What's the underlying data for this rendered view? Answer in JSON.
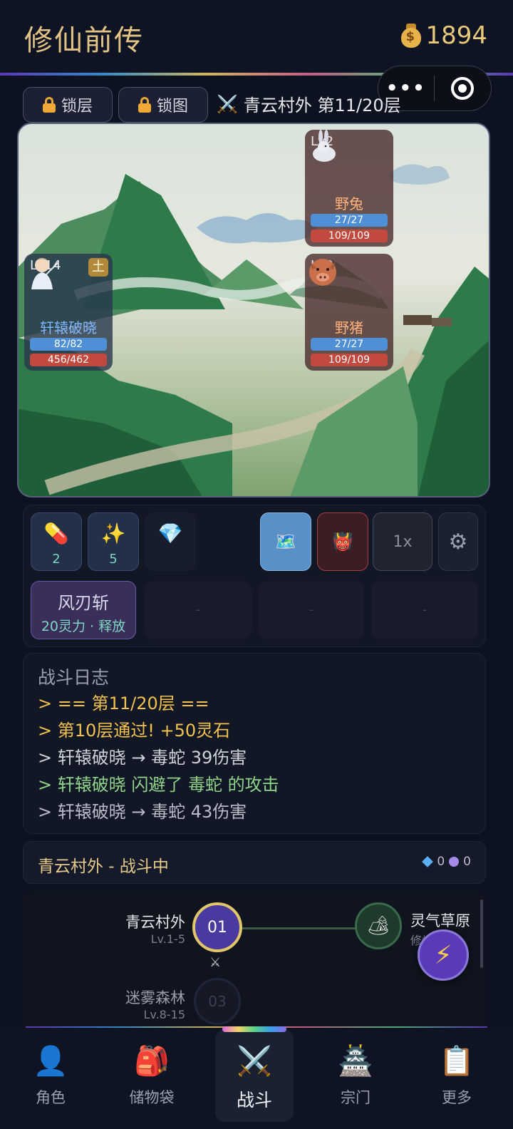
{
  "app": {
    "title": "修仙前传",
    "coins": "1894"
  },
  "toolbar": {
    "lock_floor": "锁层",
    "lock_map": "锁图",
    "stage": "青云村外 第11/20层"
  },
  "battle": {
    "hero": {
      "level": "Lv14",
      "element": "土",
      "name": "轩辕破晓",
      "mp": "82/82",
      "hp": "456/462"
    },
    "enemies": [
      {
        "level": "Lv2",
        "name": "野兔",
        "mp": "27/27",
        "hp": "109/109",
        "icon": "rabbit-icon"
      },
      {
        "level": "Lv2",
        "name": "野猪",
        "mp": "27/27",
        "hp": "109/109",
        "icon": "boar-icon"
      }
    ]
  },
  "items": [
    {
      "icon": "pill-icon",
      "count": "2"
    },
    {
      "icon": "sparkle-icon",
      "count": "5"
    },
    {
      "icon": "gem-icon",
      "count": ""
    }
  ],
  "controls": {
    "speed": "1x"
  },
  "skills": [
    {
      "name": "风刃斩",
      "cost": "20灵力 · 释放"
    },
    {
      "name": "-"
    },
    {
      "name": "-"
    },
    {
      "name": "-"
    }
  ],
  "log": {
    "title": "战斗日志",
    "lines": [
      {
        "text": "> == 第11/20层 ==",
        "color": "#f2c14e"
      },
      {
        "text": "> 第10层通过! +50灵石",
        "color": "#f2c14e"
      },
      {
        "text": "> 轩辕破晓 → 毒蛇 39伤害",
        "color": "#d0d2da"
      },
      {
        "text": "> 轩辕破晓 闪避了 毒蛇 的攻击",
        "color": "#8fd48a"
      },
      {
        "text": "> 轩辕破晓 → 毒蛇 43伤害",
        "color": "#b8bcc8"
      }
    ]
  },
  "status": {
    "text": "青云村外 - 战斗中",
    "gems": "0",
    "orbs": "0"
  },
  "map": {
    "nodes": [
      {
        "id": "01",
        "name": "青云村外",
        "level": "Lv.1-5"
      },
      {
        "id": "",
        "name": "灵气草原",
        "level": "修炼..."
      },
      {
        "id": "03",
        "name": "迷雾森林",
        "level": "Lv.8-15"
      }
    ]
  },
  "nav": [
    {
      "label": "角色",
      "icon": "person-icon"
    },
    {
      "label": "储物袋",
      "icon": "backpack-icon"
    },
    {
      "label": "战斗",
      "icon": "crossed-swords-icon"
    },
    {
      "label": "宗门",
      "icon": "pagoda-icon"
    },
    {
      "label": "更多",
      "icon": "clipboard-icon"
    }
  ]
}
